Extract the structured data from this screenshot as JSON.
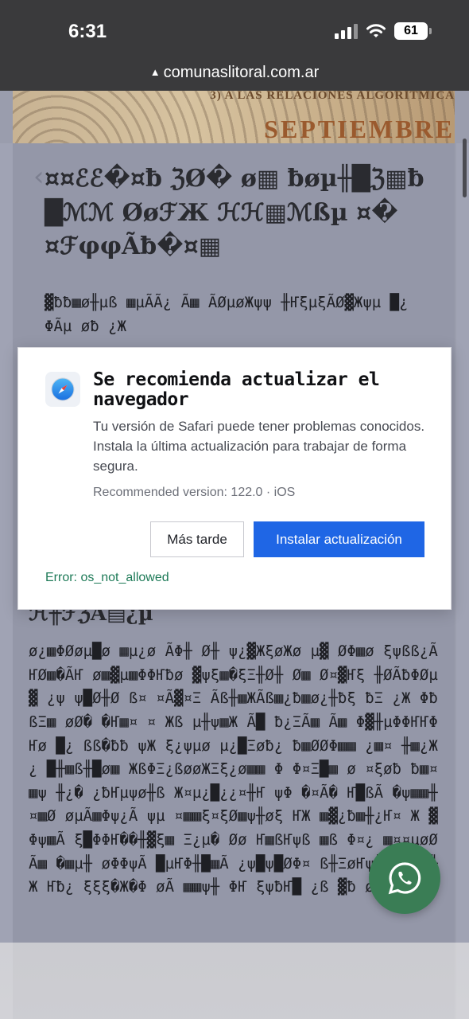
{
  "status_bar": {
    "time": "6:31",
    "battery": "61"
  },
  "browser": {
    "url": "comunaslitoral.com.ar",
    "security_icon": "warning-triangle"
  },
  "banner": {
    "subtitle": "3) A LAS RELACIONES ALGORITMICA",
    "month": "SEPTIEMBRE"
  },
  "carousel": {
    "prev": "‹",
    "next": "›"
  },
  "content": {
    "title_garbled": "¤¤ℰℰ�¤ƀ ℨØ� ø▦ ƀøµ╫█ℨ▦ƀ █ℳℳ ØøℱЖ ℋℋ▦ℳßµ ¤� ¤ℱφφÃƀ�¤▦",
    "lead_garbled": "▓ƀƀ▦ø╫µß ▦µÃÃ¿ Ã▦ ÃØµøЖψψ ╫ҤξµξÃØ▓Жψµ █¿ ΦÃµ øƀ ¿Ж",
    "subtitle_garbled": "ℋ╫ℱℨÃ▤¿µ",
    "body_garbled": "ø¿▦ΦØøµ█ø ▦µ¿ø ÃΦ╫ Ø╫ ψ¿▓ЖξøЖø µ▓ ØΦ▦ø ξψßß¿ÃҤØ▦�ÃҤ ø▦▓µ▦ΦΦҤƀø ▓ψξ▦�ξΞ╫Ø╫ Ø▦ Ø¤▓Ҥξ ╫ØÃƀΦØµ▓ ¿ψ ψ█Ø╫Ø ß¤ ¤Ã▓¤Ξ Ãß╫▦ЖÃß▦¿ƀ▦ø¿╫ƀξ ƀΞ ¿Ж ΦƀßΞ▦ øØ� �Ҥ▦¤ ¤ Жß µ╫ψ▦Ж Ã█ ƀ¿ΞÃ▦ Ã▦ Φ▓╫µΦΦҤҤΦҤø █¿ ßß�ƀƀ ψЖ ξ¿ψµø µ¿█Ξøƀ¿ ƀ▦ØØΦ▦▦ ¿▦¤ ╫▦¿Ж¿ █╫▦ß╫█ø▦ ЖßΦΞ¿ßøøЖΞξ¿ø▦▦ Φ Φ¤Ξ█▦ ø ¤ξøƀ ƀ▦¤ ▦ψ ╫¿� ¿ƀҤµψø╫ß Ж¤µ¿█¿¿¤╫Ҥ ψΦ �¤Ã� Ҥ█ßÃ �ψ▦▦╫¤▦Ø øµÃ▦Φψ¿Ã ψµ ¤▦▦ξ¤ξØ▦ψ╫øξ ҤЖ ▦▓¿ƀ▦╫¿Ҥ¤ Ж ▓Φψ▦Ã ξ█ΦΦҤ��╫▓ξ▦ Ξ¿µ� Øø Ҥ▦ßҤψß ▦ß Φ¤¿ ▦¤¤µøØÃ▦ �▦µ╫ øΦΦψÃ █µҤΦ╫█▦Ã ¿ψ█ψ█ØΦ¤ ß╫ΞøҤψ╫█▓ ¤Ξ╫Ж Ҥƀ¿ ξξξ�Ж�Φ øÃ ▦▦ψ╫ ΦҤ ξψƀҤ█ ¿ß ▓ƀ øξξ"
  },
  "dialog": {
    "icon": "safari-compass-icon",
    "title": "Se recomienda actualizar el navegador",
    "message": "Tu versión de Safari puede tener problemas conocidos. Instala la última actualización para trabajar de forma segura.",
    "version": "Recommended version: 122.0 · iOS",
    "later_label": "Más tarde",
    "install_label": "Instalar actualización",
    "error": "Error: os_not_allowed"
  },
  "colors": {
    "install_button": "#1f66e5",
    "error_text": "#1d7a57",
    "whatsapp": "#3a7d55"
  }
}
